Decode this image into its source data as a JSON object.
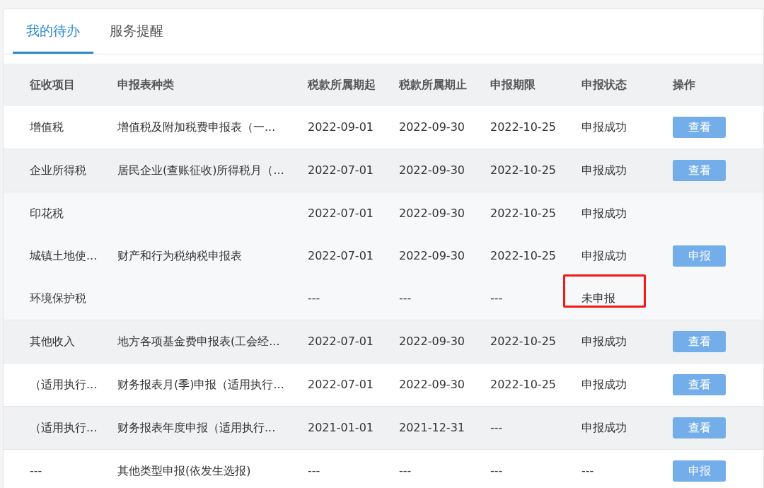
{
  "tabs": [
    {
      "label": "我的待办",
      "selected": true
    },
    {
      "label": "服务提醒",
      "selected": false
    }
  ],
  "table": {
    "columns": [
      "征收项目",
      "申报表种类",
      "税款所属期起",
      "税款所属期止",
      "申报期限",
      "申报状态",
      "操作"
    ],
    "rows": [
      {
        "kind": "row",
        "striped": false,
        "cells": [
          "增值税",
          "增值税及附加税费申报表（一...",
          "2022-09-01",
          "2022-09-30",
          "2022-10-25",
          "申报成功"
        ],
        "action": "查看",
        "highlighted": false
      },
      {
        "kind": "row",
        "striped": true,
        "cells": [
          "企业所得税",
          "居民企业(查账征收)所得税月（...",
          "2022-07-01",
          "2022-09-30",
          "2022-10-25",
          "申报成功"
        ],
        "action": "查看",
        "highlighted": false
      },
      {
        "kind": "group",
        "rows": [
          {
            "cells": [
              "印花税",
              "",
              "2022-07-01",
              "2022-09-30",
              "2022-10-25",
              "申报成功"
            ],
            "highlighted": false
          },
          {
            "cells": [
              "城镇土地使...",
              "财产和行为税纳税申报表",
              "2022-07-01",
              "2022-09-30",
              "2022-10-25",
              "申报成功"
            ],
            "action": "申报",
            "highlighted": false
          },
          {
            "cells": [
              "环境保护税",
              "",
              "---",
              "---",
              "---",
              "未申报"
            ],
            "highlighted": true
          }
        ]
      },
      {
        "kind": "row",
        "striped": true,
        "cells": [
          "其他收入",
          "地方各项基金费申报表(工会经...",
          "2022-07-01",
          "2022-09-30",
          "2022-10-25",
          "申报成功"
        ],
        "action": "查看",
        "highlighted": false
      },
      {
        "kind": "row",
        "striped": false,
        "cells": [
          "（适用执行...",
          "财务报表月(季)申报（适用执行...",
          "2022-07-01",
          "2022-09-30",
          "2022-10-25",
          "申报成功"
        ],
        "action": "查看",
        "highlighted": false
      },
      {
        "kind": "row",
        "striped": true,
        "cells": [
          "（适用执行...",
          "财务报表年度申报（适用执行...",
          "2021-01-01",
          "2021-12-31",
          "---",
          "申报成功"
        ],
        "action": "查看",
        "highlighted": false
      },
      {
        "kind": "row",
        "striped": false,
        "cells": [
          "---",
          "其他类型申报(依发生选报)",
          "---",
          "---",
          "---",
          "---"
        ],
        "action": "申报",
        "highlighted": false
      }
    ]
  }
}
